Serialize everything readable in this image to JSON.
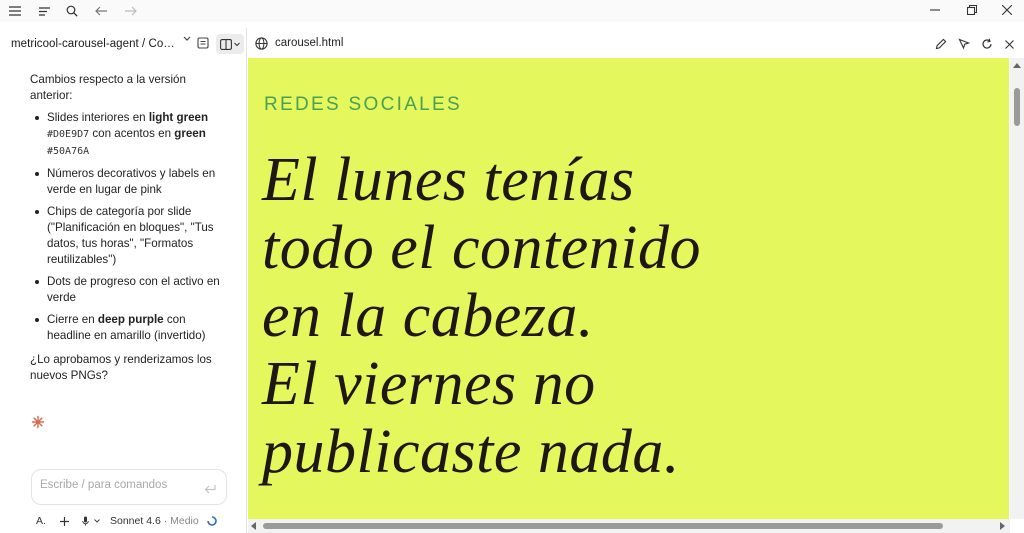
{
  "titlebar": {
    "icons": [
      "menu-icon",
      "list-icon",
      "search-icon",
      "back-arrow-icon",
      "forward-arrow-icon"
    ],
    "window_controls": [
      "minimize-icon",
      "restore-icon",
      "close-icon"
    ]
  },
  "left_panel": {
    "breadcrumb": "metricool-carousel-agent / Co…",
    "messages": {
      "intro": "Cambios respecto a la versión anterior:",
      "bullets": [
        {
          "a": "Slides interiores en ",
          "b": "light green",
          "c": " ",
          "code1": "#D0E9D7",
          "d": " con acentos en ",
          "e": "green",
          "f": " ",
          "code2": "#50A76A"
        },
        {
          "text": "Números decorativos y labels en verde en lugar de pink"
        },
        {
          "text": "Chips de categoría por slide (\"Planificación en bloques\", \"Tus datos, tus horas\", \"Formatos reutilizables\")"
        },
        {
          "text": "Dots de progreso con el activo en verde"
        },
        {
          "a": "Cierre en ",
          "b": "deep purple",
          "c": " con headline en amarillo (invertido)"
        }
      ],
      "question": "¿Lo aprobamos y renderizamos los nuevos PNGs?"
    },
    "input": {
      "placeholder": "Escribe / para comandos"
    },
    "bottombar": {
      "font_label": "A.",
      "model": "Sonnet 4.6",
      "mode": " · Medio"
    }
  },
  "right_panel": {
    "url": "carousel.html",
    "preview": {
      "kicker": "REDES SOCIALES",
      "headline_lines": [
        "El lunes tenías",
        "todo el contenido",
        "en la cabeza.",
        "El viernes no",
        "publicaste nada."
      ]
    }
  },
  "colors": {
    "preview_bg": "#E4F75C",
    "kicker": "#4AA055",
    "headline": "#1F1712",
    "spark": "#D9694C"
  }
}
